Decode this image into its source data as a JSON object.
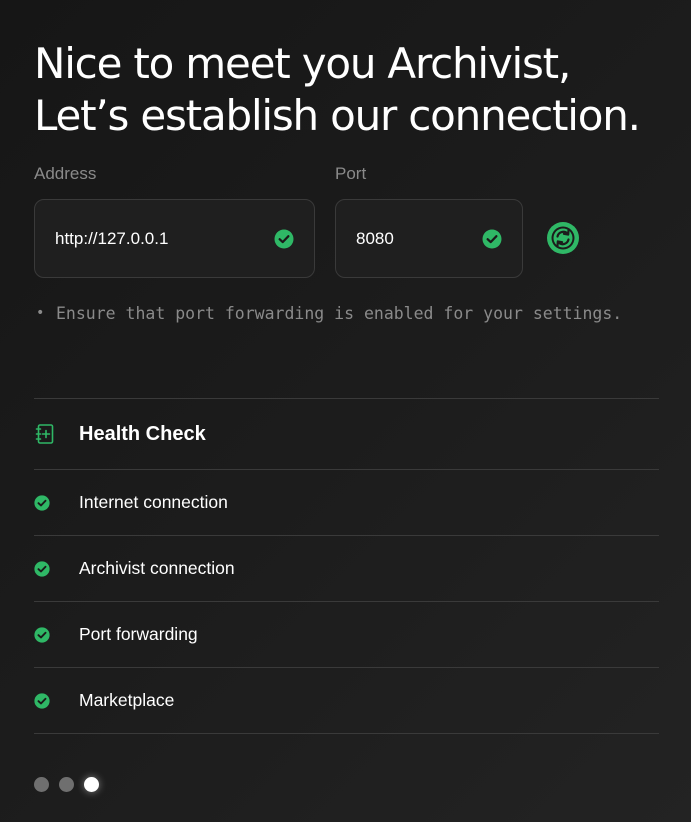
{
  "heading": {
    "line1": "Nice to meet you Archivist,",
    "line2": "Let’s establish our connection."
  },
  "address": {
    "label": "Address",
    "value": "http://127.0.0.1",
    "status_icon": "check-circle-icon"
  },
  "port": {
    "label": "Port",
    "value": "8080",
    "status_icon": "check-circle-icon"
  },
  "refresh": {
    "icon": "refresh-icon"
  },
  "hint": {
    "text": "Ensure that port forwarding is enabled for your settings."
  },
  "health_check": {
    "title": "Health Check",
    "icon": "medical-notebook-icon",
    "items": [
      {
        "label": "Internet connection",
        "status": "ok"
      },
      {
        "label": "Archivist connection",
        "status": "ok"
      },
      {
        "label": "Port forwarding",
        "status": "ok"
      },
      {
        "label": "Marketplace",
        "status": "ok"
      }
    ]
  },
  "pager": {
    "total": 3,
    "current": 3
  },
  "colors": {
    "accent_green": "#2fb866",
    "background": "#1a1a1a",
    "muted_text": "#8a8a8a",
    "border": "#3a3a3a"
  }
}
